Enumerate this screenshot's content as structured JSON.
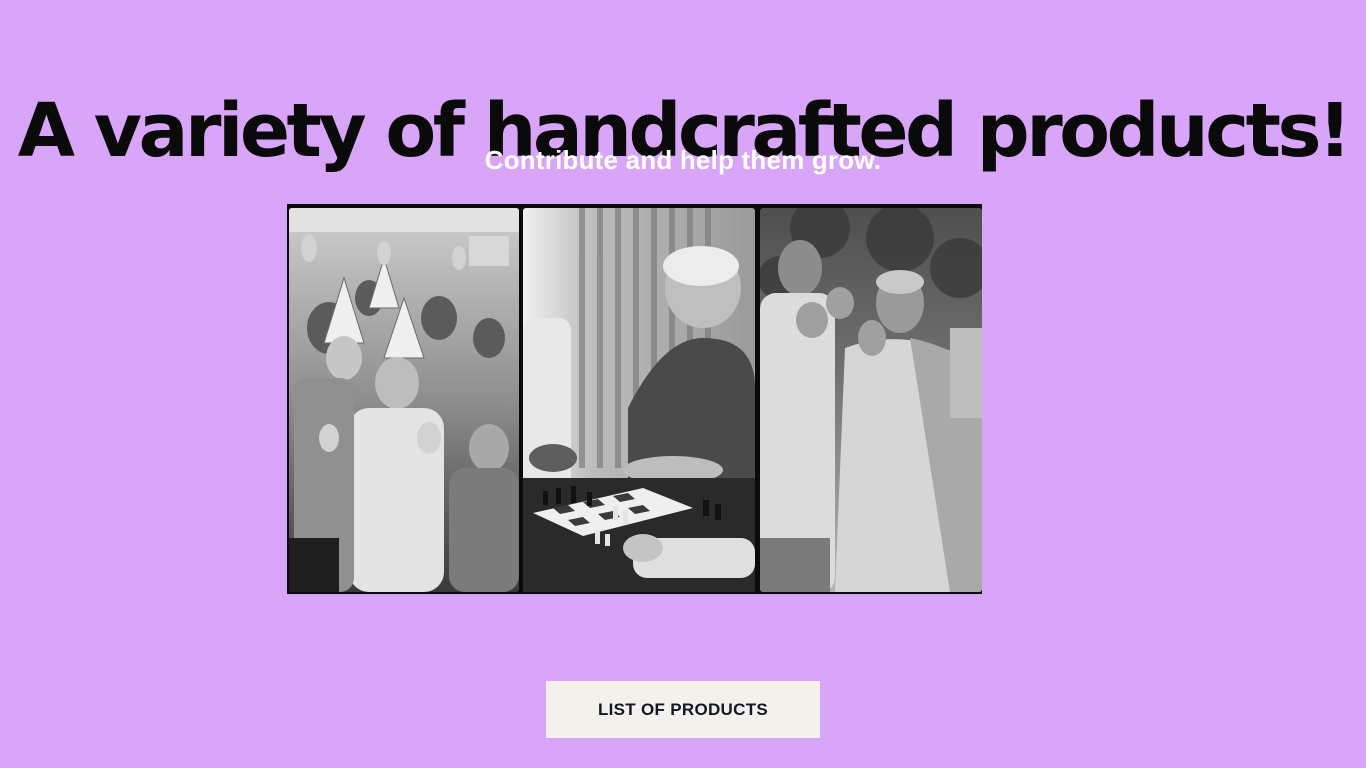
{
  "hero": {
    "headline": "A variety of handcrafted products!",
    "subheadline": "Contribute and help them grow."
  },
  "collage": {
    "panels": [
      {
        "icon": "photo-celebration"
      },
      {
        "icon": "photo-chess"
      },
      {
        "icon": "photo-couple"
      }
    ]
  },
  "cta": {
    "label": "LIST OF PRODUCTS"
  },
  "colors": {
    "background": "#d9a5f8",
    "headline": "#0a0a0a",
    "subheadline": "#ffffff",
    "button_bg": "#f4f1ec",
    "button_text": "#111827"
  }
}
